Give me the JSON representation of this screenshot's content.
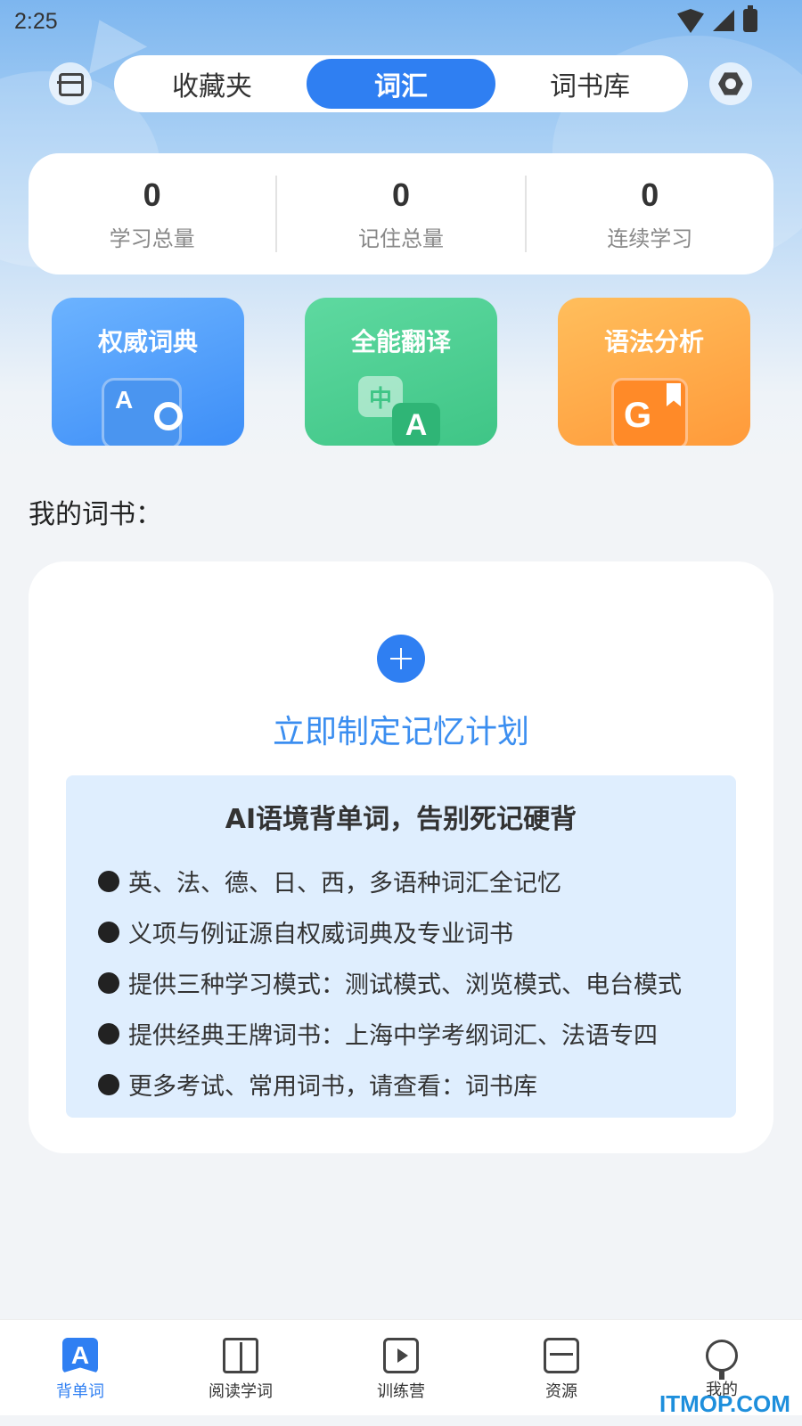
{
  "status_bar": {
    "time": "2:25"
  },
  "top_nav": {
    "tabs": [
      {
        "label": "收藏夹",
        "active": false
      },
      {
        "label": "词汇",
        "active": true
      },
      {
        "label": "词书库",
        "active": false
      }
    ],
    "left_icon": "scan-icon",
    "right_icon": "settings-icon"
  },
  "stats": [
    {
      "value": "0",
      "label": "学习总量"
    },
    {
      "value": "0",
      "label": "记住总量"
    },
    {
      "value": "0",
      "label": "连续学习"
    }
  ],
  "features": [
    {
      "title": "权威词典",
      "icon": "dictionary-search-icon",
      "color": "#4a95f0"
    },
    {
      "title": "全能翻译",
      "icon": "translate-icon",
      "color": "#3fc586"
    },
    {
      "title": "语法分析",
      "icon": "grammar-book-icon",
      "color": "#ff9a3a"
    }
  ],
  "my_books": {
    "section_title": "我的词书：",
    "add_plan_label": "立即制定记忆计划",
    "info_title": "AI语境背单词，告别死记硬背",
    "info_items": [
      "英、法、德、日、西，多语种词汇全记忆",
      "义项与例证源自权威词典及专业词书",
      "提供三种学习模式：测试模式、浏览模式、电台模式",
      "提供经典王牌词书：上海中学考纲词汇、法语专四",
      "更多考试、常用词书，请查看：词书库"
    ]
  },
  "bottom_nav": [
    {
      "label": "背单词",
      "icon": "word-icon",
      "active": true
    },
    {
      "label": "阅读学词",
      "icon": "book-icon",
      "active": false
    },
    {
      "label": "训练营",
      "icon": "video-icon",
      "active": false
    },
    {
      "label": "资源",
      "icon": "inbox-icon",
      "active": false
    },
    {
      "label": "我的",
      "icon": "user-icon",
      "active": false
    }
  ],
  "watermark": "ITMOP.COM",
  "colors": {
    "accent": "#2f7ff2",
    "plan_text": "#3b8ef0",
    "info_bg": "#dfeefe"
  }
}
